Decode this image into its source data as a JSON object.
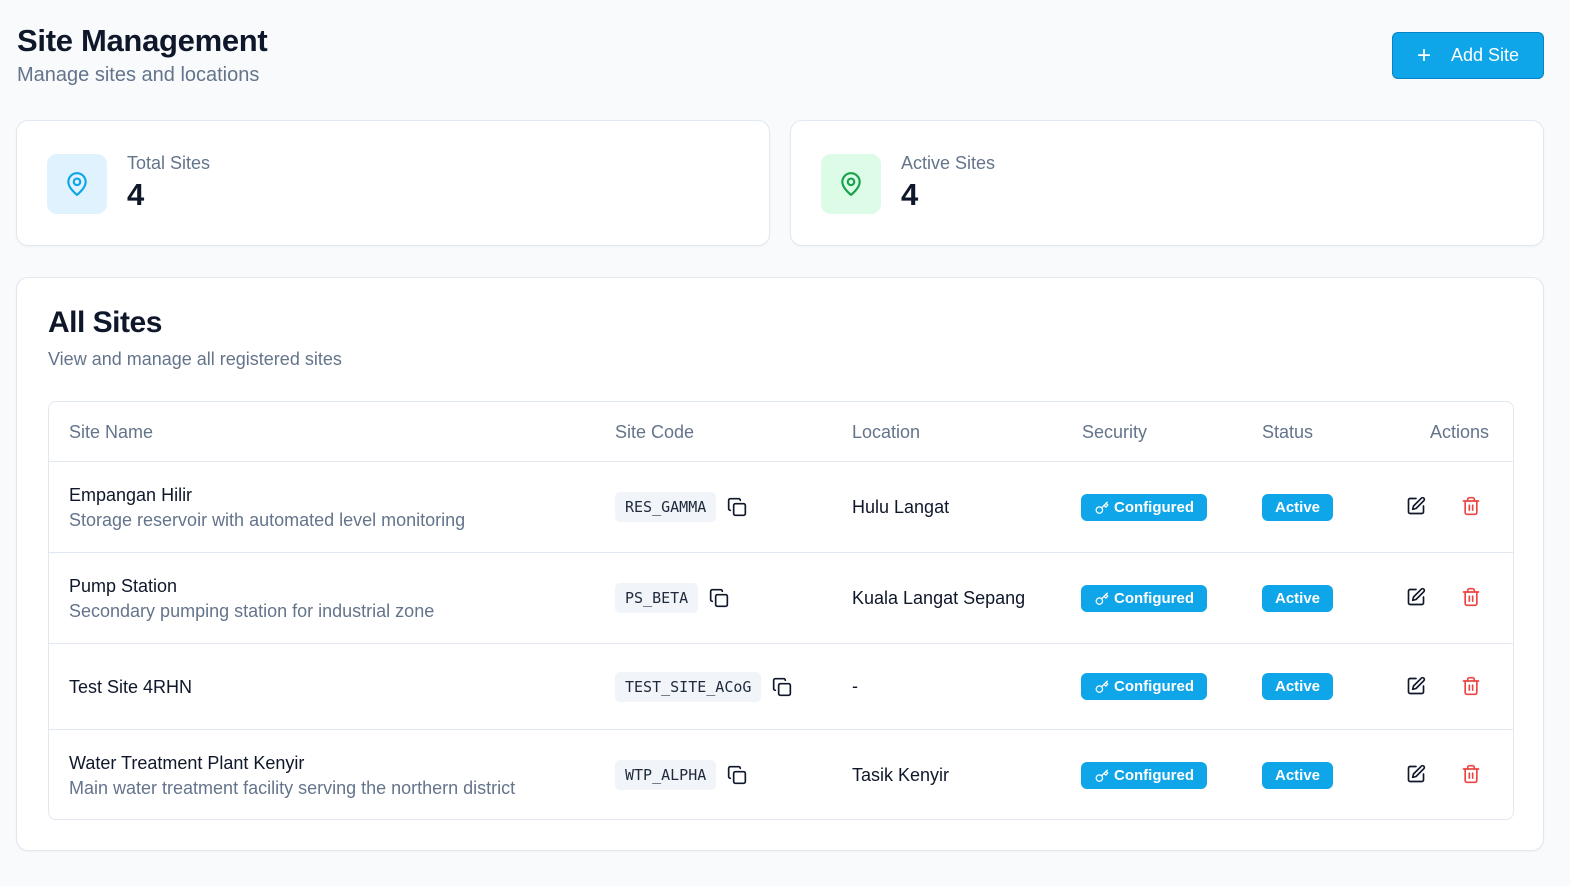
{
  "header": {
    "title": "Site Management",
    "subtitle": "Manage sites and locations",
    "add_button_label": "Add Site"
  },
  "stats": [
    {
      "label": "Total Sites",
      "value": "4",
      "icon": "map-pin-icon",
      "color": "#0ea5e9"
    },
    {
      "label": "Active Sites",
      "value": "4",
      "icon": "map-pin-icon",
      "color": "#16a34a"
    }
  ],
  "sites_card": {
    "title": "All Sites",
    "subtitle": "View and manage all registered sites"
  },
  "table": {
    "columns": [
      "Site Name",
      "Site Code",
      "Location",
      "Security",
      "Status",
      "Actions"
    ],
    "rows": [
      {
        "name": "Empangan Hilir",
        "description": "Storage reservoir with automated level monitoring",
        "code": "RES_GAMMA",
        "location": "Hulu Langat",
        "security": "Configured",
        "status": "Active"
      },
      {
        "name": "Pump Station",
        "description": "Secondary pumping station for industrial zone",
        "code": "PS_BETA",
        "location": "Kuala Langat Sepang",
        "security": "Configured",
        "status": "Active"
      },
      {
        "name": "Test Site 4RHN",
        "description": "",
        "code": "TEST_SITE_ACoG",
        "location": "-",
        "security": "Configured",
        "status": "Active"
      },
      {
        "name": "Water Treatment Plant Kenyir",
        "description": "Main water treatment facility serving the northern district",
        "code": "WTP_ALPHA",
        "location": "Tasik Kenyir",
        "security": "Configured",
        "status": "Active"
      }
    ]
  },
  "colors": {
    "accent": "#0ea5e9",
    "danger": "#ef4444",
    "success": "#16a34a"
  }
}
